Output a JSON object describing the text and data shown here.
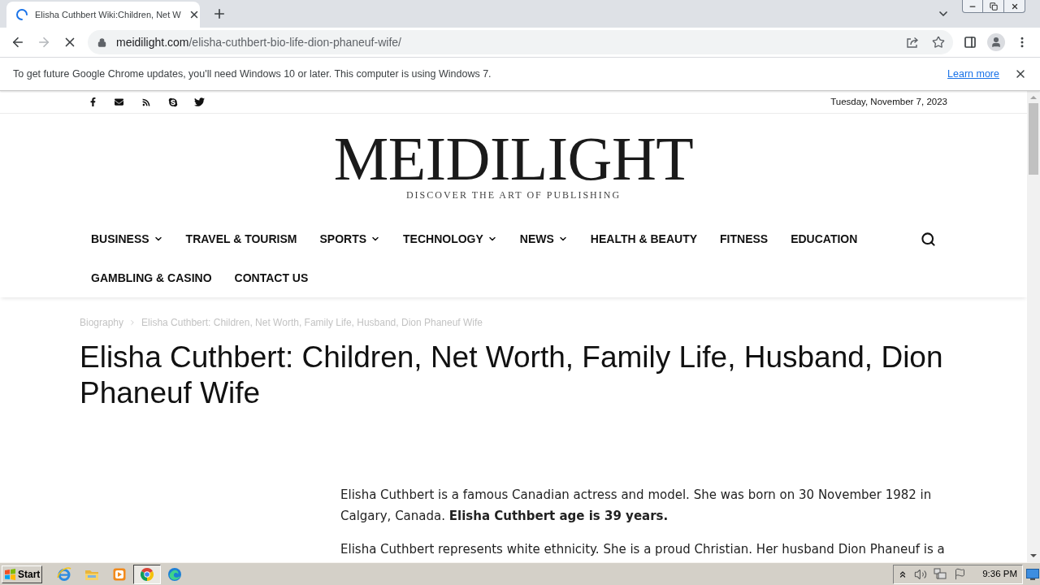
{
  "browser": {
    "tabs": [
      {
        "title": "Elisha Cuthbert Wiki:Children, Net W",
        "selected": true,
        "loading": true
      }
    ],
    "forward_enabled": false,
    "address": {
      "domain": "meidilight.com",
      "path": "/elisha-cuthbert-bio-life-dion-phaneuf-wife/"
    },
    "infobar": {
      "message": "To get future Google Chrome updates, you'll need Windows 10 or later. This computer is using Windows 7.",
      "link": "Learn more"
    }
  },
  "site": {
    "date": "Tuesday, November 7, 2023",
    "logo": "MEIDILIGHT",
    "tagline": "DISCOVER THE ART OF PUBLISHING",
    "nav": [
      {
        "label": "BUSINESS",
        "dropdown": true
      },
      {
        "label": "TRAVEL & TOURISM",
        "dropdown": false
      },
      {
        "label": "SPORTS",
        "dropdown": true
      },
      {
        "label": "TECHNOLOGY",
        "dropdown": true
      },
      {
        "label": "NEWS",
        "dropdown": true
      },
      {
        "label": "HEALTH & BEAUTY",
        "dropdown": false
      },
      {
        "label": "FITNESS",
        "dropdown": false
      },
      {
        "label": "EDUCATION",
        "dropdown": false
      },
      {
        "label": "GAMBLING & CASINO",
        "dropdown": false
      },
      {
        "label": "CONTACT US",
        "dropdown": false
      }
    ]
  },
  "breadcrumb": [
    {
      "label": "Biography"
    },
    {
      "label": "Elisha Cuthbert: Children, Net Worth, Family Life, Husband, Dion Phaneuf Wife"
    }
  ],
  "article": {
    "title": "Elisha Cuthbert: Children, Net Worth, Family Life, Husband, Dion Phaneuf Wife",
    "paragraphs": [
      "Elisha Cuthbert is a famous Canadian actress and model. She was born on 30 November 1982 in Calgary, Canada. **Elisha Cuthbert age is 39 years.**",
      "Elisha Cuthbert represents white ethnicity. She is a proud Christian. Her husband Dion Phaneuf is a"
    ]
  },
  "taskbar": {
    "start": "Start",
    "apps": [
      {
        "selected": false
      },
      {
        "selected": false
      },
      {
        "selected": false
      },
      {
        "selected": true
      },
      {
        "selected": false
      }
    ],
    "clock": "9:36 PM"
  }
}
